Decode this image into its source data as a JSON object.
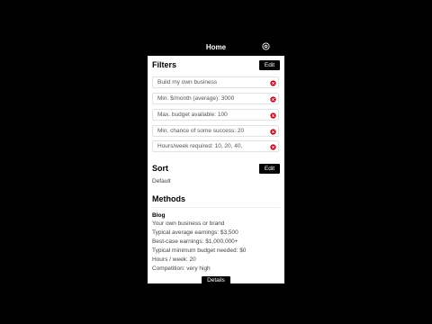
{
  "header": {
    "title": "Home",
    "settings_icon": "gear-icon"
  },
  "filters": {
    "title": "Filters",
    "edit_label": "Edit",
    "items": [
      {
        "label": "Build my own business"
      },
      {
        "label": "Min. $/month (average): 3000"
      },
      {
        "label": "Max. budget available: 100"
      },
      {
        "label": "Min. chance of some success: 20"
      },
      {
        "label": "Hours/week required: 10, 20, 40,"
      }
    ],
    "remove_icon": "remove-circle-icon",
    "remove_color": "#d0021b"
  },
  "sort": {
    "title": "Sort",
    "edit_label": "Edit",
    "value": "Default"
  },
  "methods": {
    "title": "Methods",
    "items": [
      {
        "name": "Blog",
        "details": [
          "Your own business or brand",
          "Typical average earnings: $3,500",
          "Best-case earnings: $1,000,000+",
          "Typical minimum budget needed: $0",
          "Hours / week: 20",
          "Competition: very high"
        ],
        "details_button_label": "Details"
      }
    ]
  }
}
